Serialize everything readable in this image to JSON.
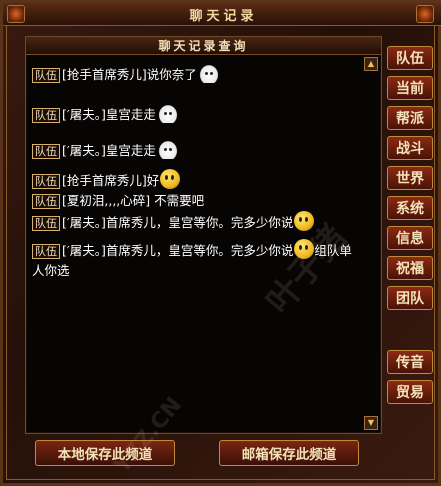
{
  "window": {
    "title": "聊天记录"
  },
  "panel": {
    "header": "聊天记录查询"
  },
  "messages": [
    {
      "channel": "队伍",
      "text": "[抢手首席秀儿]说你奈了",
      "emote": "cloud-face-icon"
    },
    {
      "channel": "队伍",
      "text": "[′屠夫。]皇宫走走",
      "emote": "cloud-face-icon"
    },
    {
      "channel": "队伍",
      "text": "[′屠夫。]皇宫走走",
      "emote": "cloud-face-icon"
    },
    {
      "channel": "队伍",
      "text": "[抢手首席秀儿]好",
      "emote": "smiley-icon"
    },
    {
      "channel": "队伍",
      "text": "[夏初泪,,,,心碎] 不需要吧",
      "emote": ""
    },
    {
      "channel": "队伍",
      "text": "[′屠夫。]首席秀儿，皇宫等你。完多少你说",
      "emote": "smiley-icon"
    },
    {
      "channel": "队伍",
      "text": "[′屠夫。]首席秀儿，皇宫等你。完多少你说",
      "emote": "smiley-icon",
      "tail": "组队单人你选"
    }
  ],
  "side_tabs": [
    "队伍",
    "当前",
    "帮派",
    "战斗",
    "世界",
    "系统",
    "信息",
    "祝福",
    "团队"
  ],
  "side_tabs_lower": [
    "传音",
    "贸易"
  ],
  "buttons": {
    "save_local": "本地保存此频道",
    "save_mail": "邮箱保存此频道"
  },
  "watermark": {
    "text": "叶子猪游戏网",
    "url": "YZZ.CN"
  },
  "colors": {
    "accent": "#8a2a14",
    "border": "#c08a3a",
    "text": "#ffffff"
  }
}
